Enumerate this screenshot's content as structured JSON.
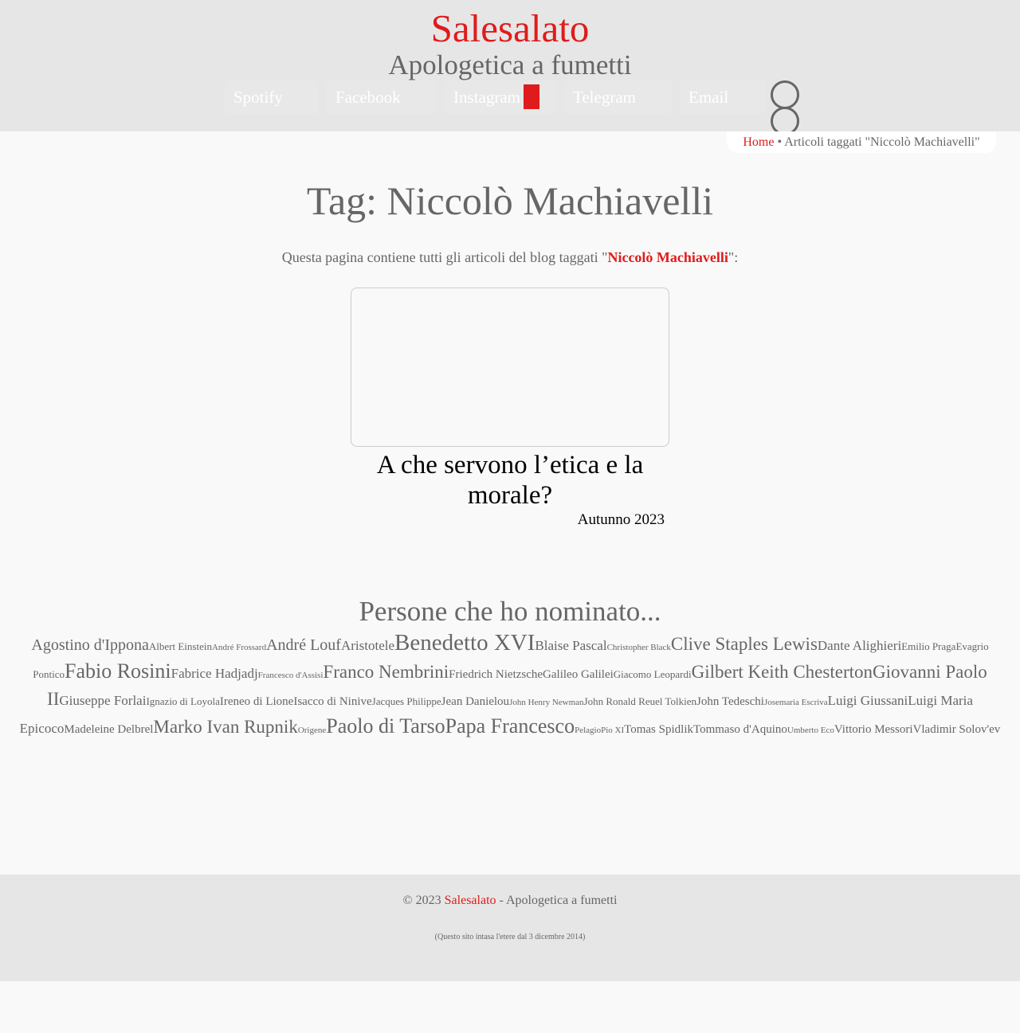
{
  "header": {
    "title": "Salesalato",
    "subtitle": "Apologetica a fumetti",
    "nav": [
      "Spotify",
      "Facebook",
      "Instagram",
      "Telegram",
      "Email"
    ]
  },
  "breadcrumb": {
    "home": "Home",
    "separator": "•",
    "current": "Articoli taggati \"Niccolò Machiavelli\""
  },
  "page": {
    "title": "Tag: Niccolò Machiavelli",
    "intro_before": "Questa pagina contiene tutti gli articoli del blog taggati \"",
    "intro_tag": "Niccolò Machiavelli",
    "intro_after": "\":"
  },
  "article": {
    "title": "A che servono l’etica e la morale?",
    "date": "Autunno 2023"
  },
  "people": {
    "title": "Persone che ho nominato...",
    "tags": [
      {
        "name": "Agostino d'Ippona",
        "size": 5
      },
      {
        "name": "Albert Einstein",
        "size": 2
      },
      {
        "name": "André Frossard",
        "size": 1
      },
      {
        "name": "André Louf",
        "size": 5
      },
      {
        "name": "Aristotele",
        "size": 4
      },
      {
        "name": "Benedetto XVI",
        "size": 8
      },
      {
        "name": "Blaise Pascal",
        "size": 4
      },
      {
        "name": "Christopher Black",
        "size": 1
      },
      {
        "name": "Clive Staples Lewis",
        "size": 6
      },
      {
        "name": "Dante Alighieri",
        "size": 4
      },
      {
        "name": "Emilio Praga",
        "size": 2
      },
      {
        "name": "Evagrio Pontico",
        "size": 2
      },
      {
        "name": "Fabio Rosini",
        "size": 7
      },
      {
        "name": "Fabrice Hadjadj",
        "size": 4
      },
      {
        "name": "Francesco d'Assisi",
        "size": 1
      },
      {
        "name": "Franco Nembrini",
        "size": 6
      },
      {
        "name": "Friedrich Nietzsche",
        "size": 3
      },
      {
        "name": "Galileo Galilei",
        "size": 3
      },
      {
        "name": "Giacomo Leopardi",
        "size": 2
      },
      {
        "name": "Gilbert Keith Chesterton",
        "size": 6
      },
      {
        "name": "Giovanni Paolo II",
        "size": 6
      },
      {
        "name": "Giuseppe Forlai",
        "size": 4
      },
      {
        "name": "Ignazio di Loyola",
        "size": 2
      },
      {
        "name": "Ireneo di Lione",
        "size": 3
      },
      {
        "name": "Isacco di Ninive",
        "size": 3
      },
      {
        "name": "Jacques Philippe",
        "size": 2
      },
      {
        "name": "Jean Danielou",
        "size": 3
      },
      {
        "name": "John Henry Newman",
        "size": 1
      },
      {
        "name": "John Ronald Reuel Tolkien",
        "size": 2
      },
      {
        "name": "John Tedeschi",
        "size": 3
      },
      {
        "name": "Josemaria Escriva",
        "size": 1
      },
      {
        "name": "Luigi Giussani",
        "size": 4
      },
      {
        "name": "Luigi Maria Epicoco",
        "size": 4
      },
      {
        "name": "Madeleine Delbrel",
        "size": 3
      },
      {
        "name": "Marko Ivan Rupnik",
        "size": 6
      },
      {
        "name": "Origene",
        "size": 1
      },
      {
        "name": "Paolo di Tarso",
        "size": 7
      },
      {
        "name": "Papa Francesco",
        "size": 7
      },
      {
        "name": "Pelagio",
        "size": 1
      },
      {
        "name": "Pio XI",
        "size": 1
      },
      {
        "name": "Tomas Spidlik",
        "size": 3
      },
      {
        "name": "Tommaso d'Aquino",
        "size": 3
      },
      {
        "name": "Umberto Eco",
        "size": 1
      },
      {
        "name": "Vittorio Messori",
        "size": 3
      },
      {
        "name": "Vladimir Solov'ev",
        "size": 3
      }
    ]
  },
  "footer": {
    "copyright": "© 2023",
    "site": "Salesalato",
    "tagline": "- Apologetica a fumetti",
    "note": "(Questo sito intasa l'etere dal 3 dicembre 2014)"
  },
  "colors": {
    "accent": "#e01b1b",
    "header_bg": "#e6e6e6",
    "page_bg": "#f9f9f9",
    "text": "#666666"
  }
}
